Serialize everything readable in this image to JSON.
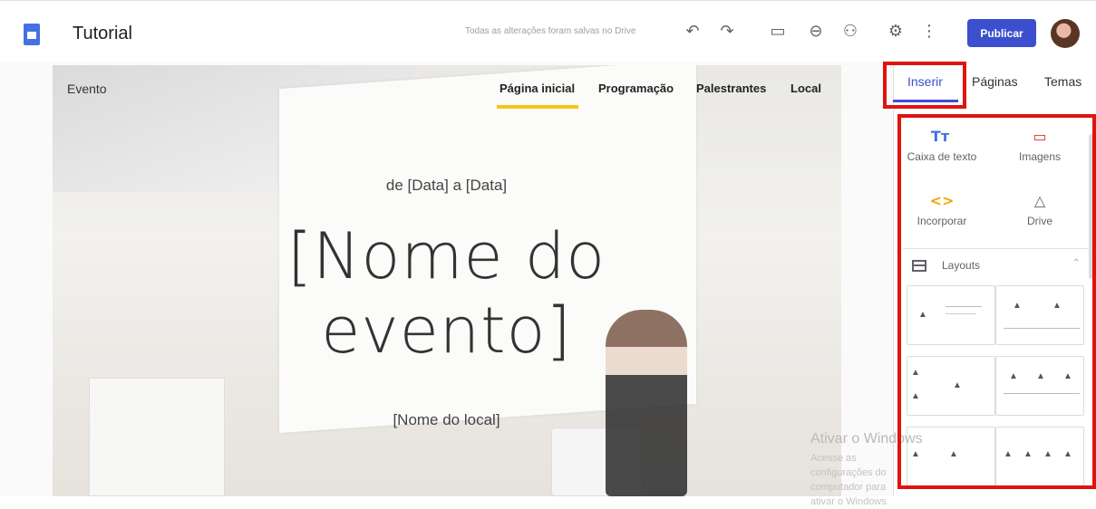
{
  "header": {
    "title": "Tutorial",
    "save_status": "Todas as alterações foram salvas no Drive",
    "publish_label": "Publicar",
    "icons": [
      "undo-icon",
      "redo-icon",
      "preview-icon",
      "link-icon",
      "share-icon",
      "settings-icon",
      "more-icon"
    ]
  },
  "site": {
    "brand": "Evento",
    "nav": [
      "Página inicial",
      "Programação",
      "Palestrantes",
      "Local"
    ],
    "date": "de [Data] a [Data]",
    "event_name_line1": "[Nome do",
    "event_name_line2": "evento]",
    "venue": "[Nome do local]"
  },
  "panel": {
    "tabs": [
      "Inserir",
      "Páginas",
      "Temas"
    ],
    "insert_items": [
      {
        "icon": "Tт",
        "label": "Caixa de texto"
      },
      {
        "icon": "▭",
        "label": "Imagens"
      },
      {
        "icon": "<>",
        "label": "Incorporar"
      },
      {
        "icon": "△",
        "label": "Drive"
      }
    ],
    "layouts_label": "Layouts"
  },
  "watermark": {
    "title": "Ativar o Windows",
    "subtitle": "Acesse as configurações do computador para ativar o Windows."
  },
  "colors": {
    "accent": "#3c4fcf",
    "highlight": "#e0140f",
    "nav_underline": "#f5c518"
  }
}
